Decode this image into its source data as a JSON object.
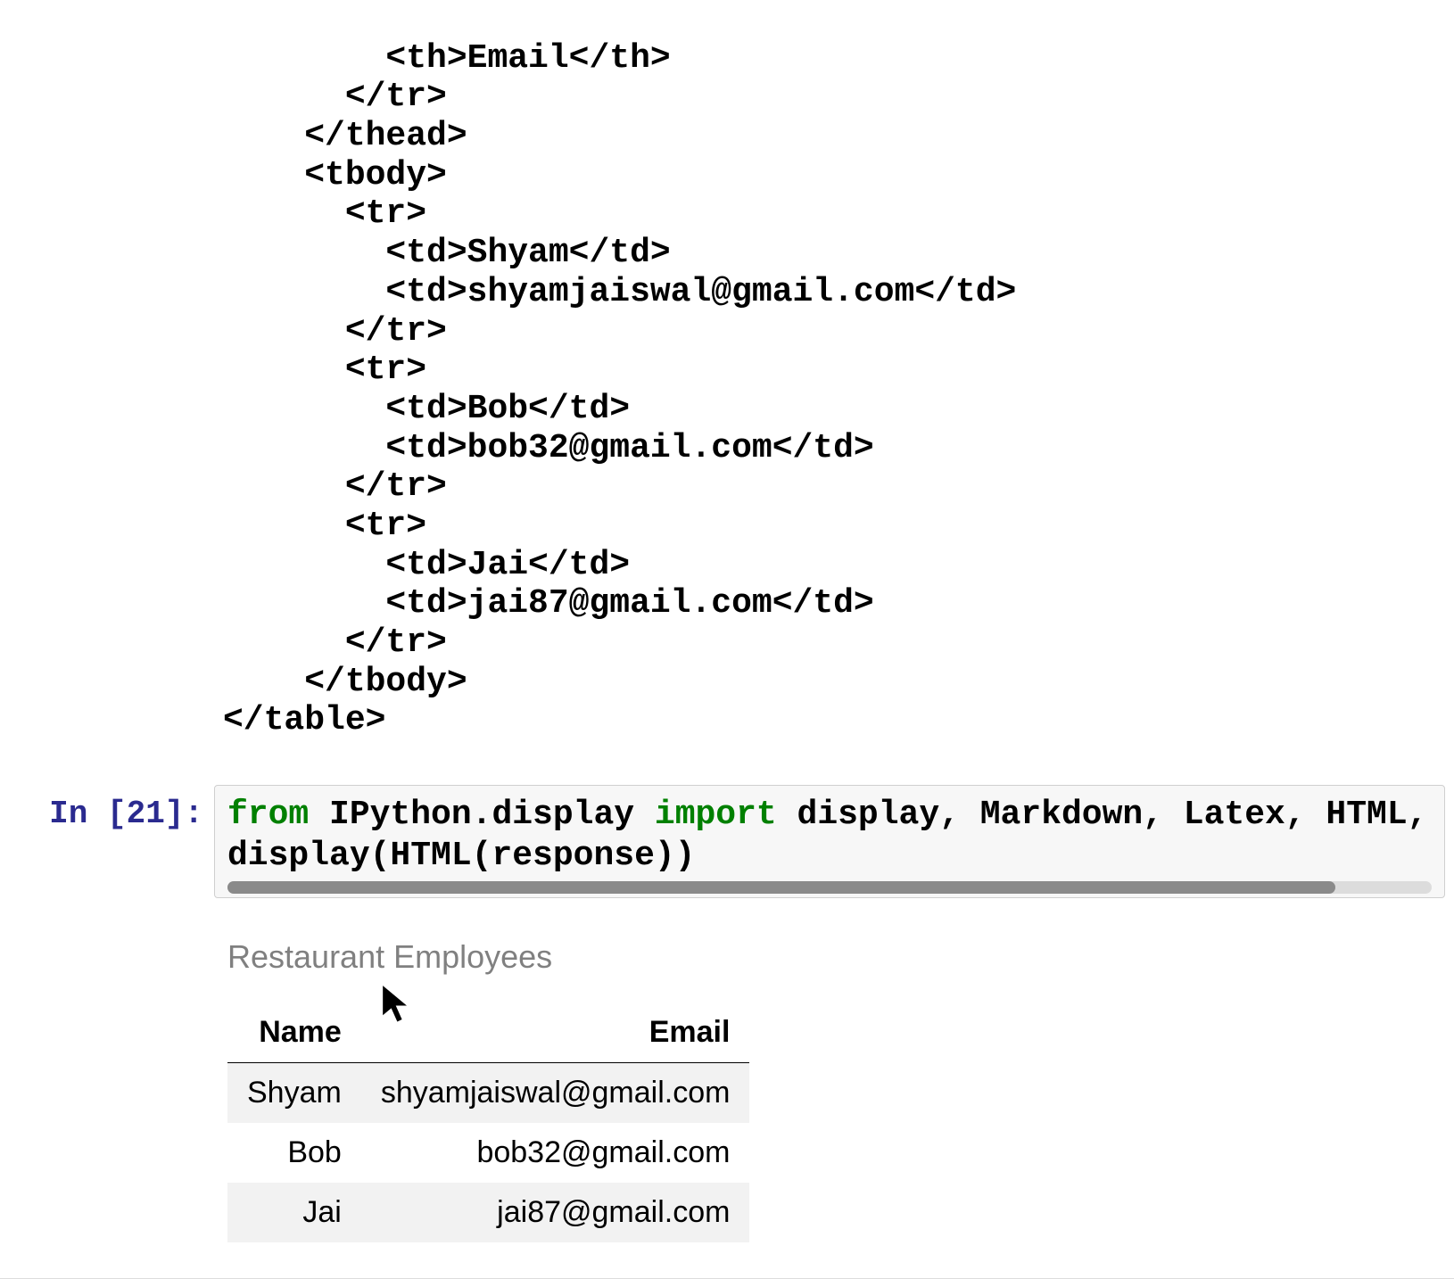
{
  "cell_output_code": {
    "line1": "        <th>Email</th>",
    "line2": "      </tr>",
    "line3": "    </thead>",
    "line4": "    <tbody>",
    "line5": "      <tr>",
    "line6": "        <td>Shyam</td>",
    "line7": "        <td>shyamjaiswal@gmail.com</td>",
    "line8": "      </tr>",
    "line9": "      <tr>",
    "line10": "        <td>Bob</td>",
    "line11": "        <td>bob32@gmail.com</td>",
    "line12": "      </tr>",
    "line13": "      <tr>",
    "line14": "        <td>Jai</td>",
    "line15": "        <td>jai87@gmail.com</td>",
    "line16": "      </tr>",
    "line17": "    </tbody>",
    "line18": "</table>"
  },
  "prompt": {
    "in_label": "In [21]:"
  },
  "code_input": {
    "kw_from": "from",
    "seg1": " IPython.display ",
    "kw_import": "import",
    "seg2": " display, Markdown, Latex, HTML, J",
    "line2": "display(HTML(response))"
  },
  "rendered": {
    "caption": "Restaurant Employees",
    "headers": {
      "name": "Name",
      "email": "Email"
    },
    "rows": [
      {
        "name": "Shyam",
        "email": "shyamjaiswal@gmail.com"
      },
      {
        "name": "Bob",
        "email": "bob32@gmail.com"
      },
      {
        "name": "Jai",
        "email": "jai87@gmail.com"
      }
    ]
  }
}
